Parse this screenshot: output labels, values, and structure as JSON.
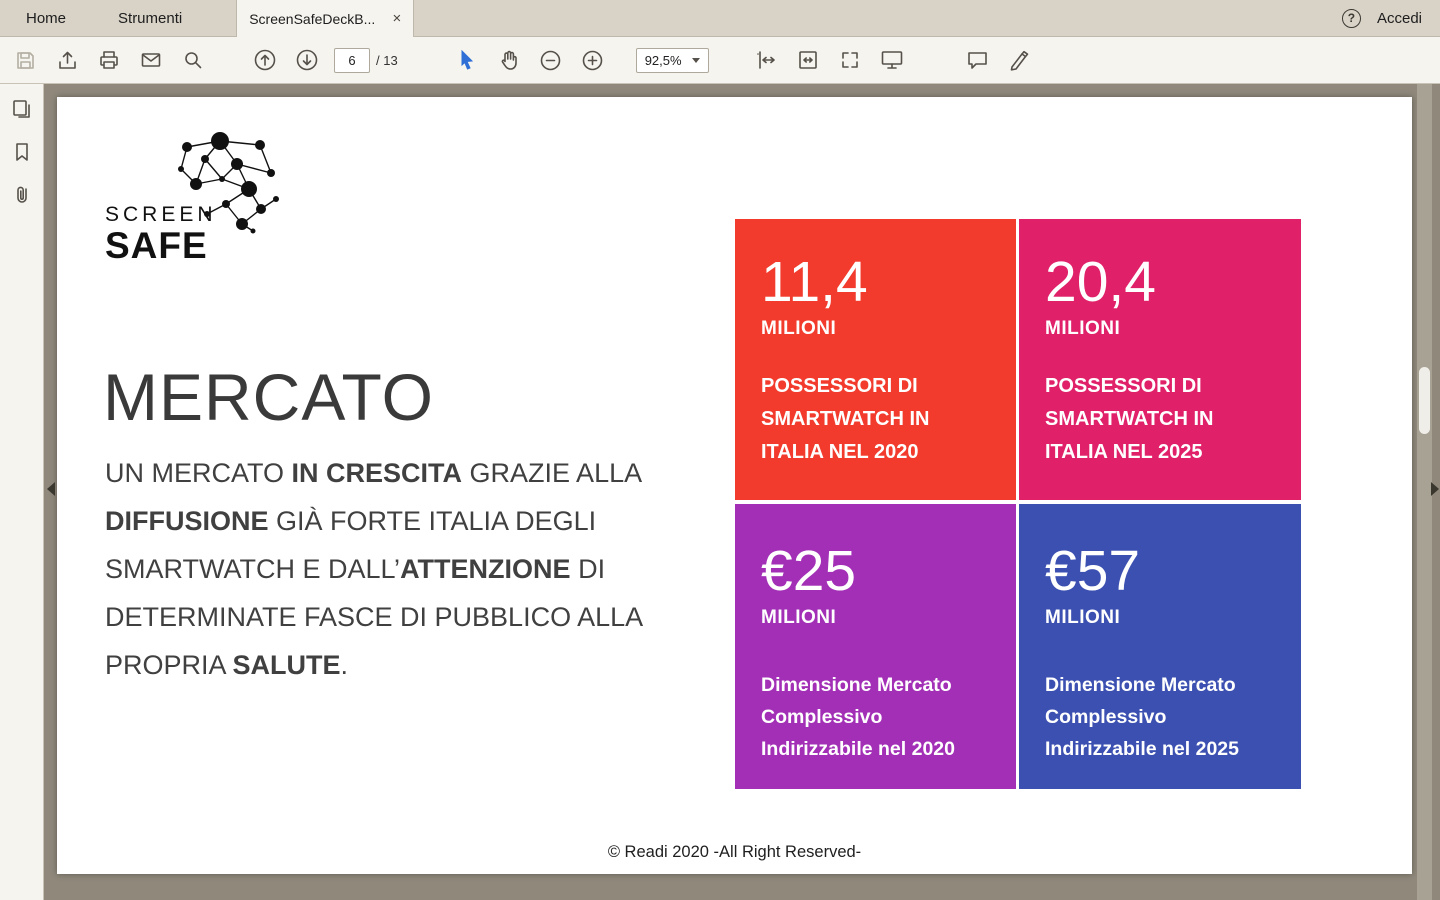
{
  "chrome": {
    "tabs": {
      "home": "Home",
      "tools": "Strumenti",
      "doc": "ScreenSafeDeckB...",
      "close": "×",
      "help": "?",
      "signin": "Accedi"
    },
    "toolbar": {
      "page": "6",
      "page_total": "/ 13",
      "zoom": "92,5%"
    }
  },
  "slide": {
    "logo": {
      "line1": "SCREEN",
      "line2": "SAFE"
    },
    "title": "MERCATO",
    "paragraph": {
      "segments": [
        {
          "text": "UN MERCATO ",
          "bold": false
        },
        {
          "text": "IN CRESCITA",
          "bold": true
        },
        {
          "text": " GRAZIE ALLA ",
          "bold": false
        },
        {
          "text": "DIFFUSIONE",
          "bold": true
        },
        {
          "text": " GIÀ FORTE ITALIA DEGLI SMARTWATCH E DALL’",
          "bold": false
        },
        {
          "text": "ATTENZIONE",
          "bold": true
        },
        {
          "text": " DI DETERMINATE FASCE DI PUBBLICO ALLA PROPRIA ",
          "bold": false
        },
        {
          "text": "SALUTE",
          "bold": true
        },
        {
          "text": ".",
          "bold": false
        }
      ]
    },
    "boxes": [
      {
        "value": "11,4",
        "unit": "MILIONI",
        "desc": "POSSESSORI DI SMARTWATCH IN ITALIA NEL 2020",
        "color": "#F23B2C"
      },
      {
        "value": "20,4",
        "unit": "MILIONI",
        "desc": "POSSESSORI DI SMARTWATCH IN ITALIA NEL 2025",
        "color": "#E02069"
      },
      {
        "value": "€25",
        "unit": "MILIONI",
        "desc": "Dimensione Mercato Complessivo Indirizzabile nel 2020",
        "color": "#A22FB6"
      },
      {
        "value": "€57",
        "unit": "MILIONI",
        "desc": "Dimensione Mercato Complessivo Indirizzabile nel 2025",
        "color": "#3C50B1"
      }
    ],
    "footer": "© Readi 2020 -All Right Reserved-"
  }
}
